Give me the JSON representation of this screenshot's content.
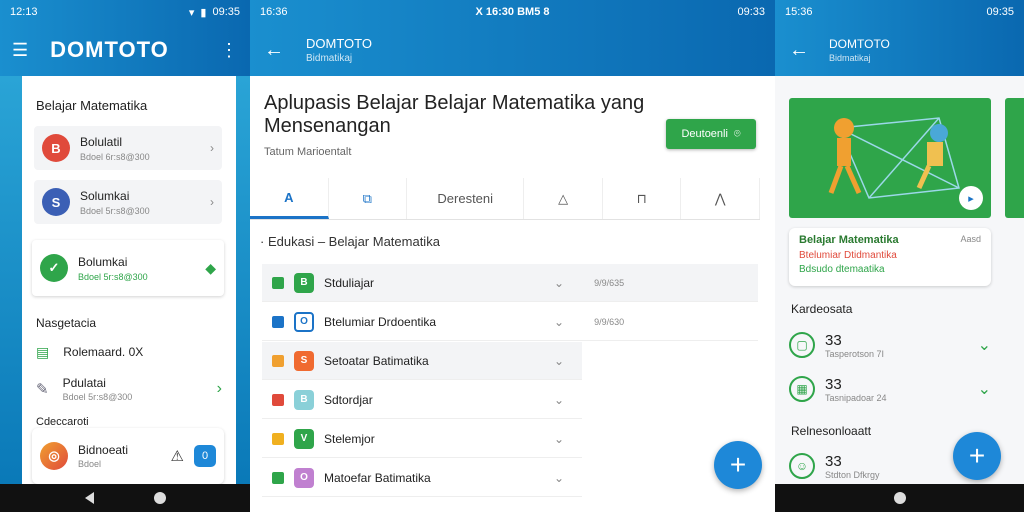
{
  "panel1": {
    "status": {
      "time": "12:13",
      "right_time": "09:35"
    },
    "app": {
      "logo": "DOMTOTO"
    },
    "section_title": "Belajar Matematika",
    "items": [
      {
        "title": "Bolulatil",
        "subtitle": "Bdoel 6r:s8@300",
        "icon": "B",
        "color": "#e04a3b"
      },
      {
        "title": "Solumkai",
        "subtitle": "Bdoel 5r:s8@300",
        "icon": "S",
        "color": "#3b5fb5"
      },
      {
        "title": "Bolumkai",
        "subtitle": "Bdoel 5r:s8@300",
        "icon": "✓",
        "color": "#2fa54a"
      }
    ],
    "nav_title": "Nasgetacia",
    "nav_items": [
      {
        "title": "Rolemaard. 0X"
      },
      {
        "title": "Pdulatai",
        "subtitle": "Bdoel 5r:s8@300"
      }
    ],
    "other_title": "Cdeccaroti",
    "bottom_item": {
      "title": "Bidnoeati",
      "subtitle": "Bdoel",
      "badge": "0"
    }
  },
  "panel2": {
    "status": {
      "time": "16:36",
      "center": "X 16:30  BM5 8",
      "right_time": "09:33"
    },
    "app": {
      "title": "DOMTOTO",
      "subtitle": "Bidmatikaj"
    },
    "heading": "Aplupasis Belajar Belajar Matematika yang Mensenangan",
    "sub": "Tatum Marioentalt",
    "download_btn": "Deutoenli",
    "tabs": [
      "A",
      "",
      "Deresteni",
      "",
      "",
      ""
    ],
    "breadcrumb": "Edukasi – Belajar Matematika",
    "rows": [
      {
        "label": "Stduliajar",
        "meta": "9/9/635",
        "sq": "#2fa54a",
        "ic": "#2fa54a",
        "icon": "B"
      },
      {
        "label": "Btelumiar Drdoentika",
        "meta": "9/9/630",
        "sq": "#1b73c7",
        "ic": "#1b73c7",
        "icon": "O"
      },
      {
        "label": "Setoatar Batimatika",
        "meta": "",
        "sq": "#f0a030",
        "ic": "#f06a30",
        "icon": "S"
      },
      {
        "label": "Sdtordjar",
        "meta": "",
        "sq": "#e04a3b",
        "ic": "#8ad0d8",
        "icon": "B"
      },
      {
        "label": "Stelemjor",
        "meta": "",
        "sq": "#f0b020",
        "ic": "#2fa54a",
        "icon": "V"
      },
      {
        "label": "Matoefar Batimatika",
        "meta": "",
        "sq": "#2fa54a",
        "ic": "#c080d0",
        "icon": "O"
      }
    ]
  },
  "panel3": {
    "status": {
      "time": "15:36",
      "right_time": "09:35"
    },
    "app": {
      "title": "DOMTOTO",
      "subtitle": "Bidmatikaj"
    },
    "card_title": "Belajar Matematika",
    "card_author": "Aasd",
    "card_sub1": "Btelumiar Dtidmantika",
    "card_sub2": "Bdsudo dtemaatika",
    "section1": "Kardeosata",
    "stats": [
      {
        "value": "33",
        "label": "Tasperotson 7I"
      },
      {
        "value": "33",
        "label": "Tasnipadoar 24"
      }
    ],
    "section2": "Relnesonloaatt",
    "stat3": {
      "value": "33",
      "label": "Stdton Dfkrgy"
    }
  },
  "colors": {
    "primary": "#1b73c7",
    "green": "#2fa54a",
    "appbar": "#0a68b0"
  }
}
